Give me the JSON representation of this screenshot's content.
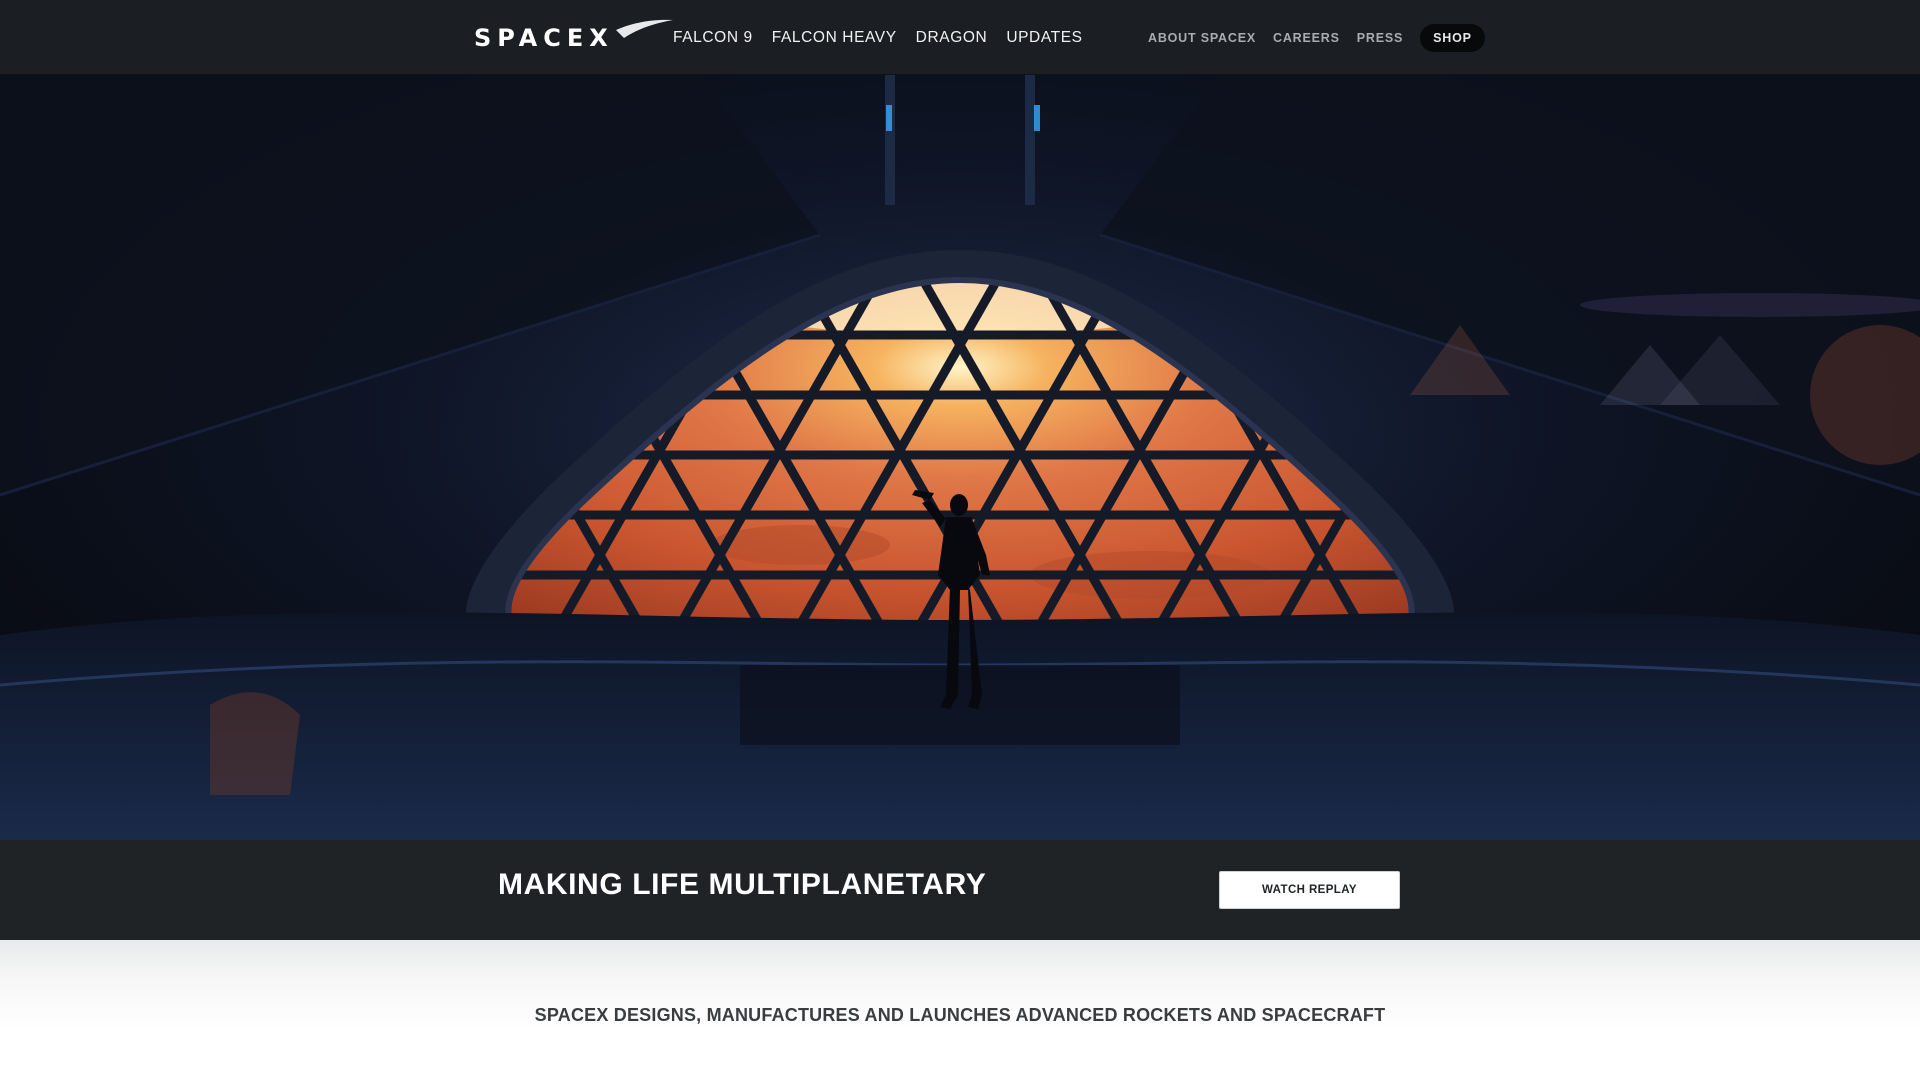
{
  "nav": {
    "logo_text": "SPACEX",
    "primary": [
      {
        "label": "FALCON 9"
      },
      {
        "label": "FALCON HEAVY"
      },
      {
        "label": "DRAGON"
      },
      {
        "label": "UPDATES"
      }
    ],
    "secondary": [
      {
        "label": "ABOUT SPACEX"
      },
      {
        "label": "CAREERS"
      },
      {
        "label": "PRESS"
      }
    ],
    "shop_label": "SHOP"
  },
  "hero": {
    "headline": "MAKING LIFE MULTIPLANETARY",
    "cta_label": "WATCH REPLAY"
  },
  "intro": {
    "tagline": "SPACEX DESIGNS, MANUFACTURES AND LAUNCHES ADVANCED ROCKETS AND SPACECRAFT"
  },
  "colors": {
    "nav_bg": "#1b1e22",
    "caption_bg": "#1f2326",
    "mars": "#d9643a"
  }
}
